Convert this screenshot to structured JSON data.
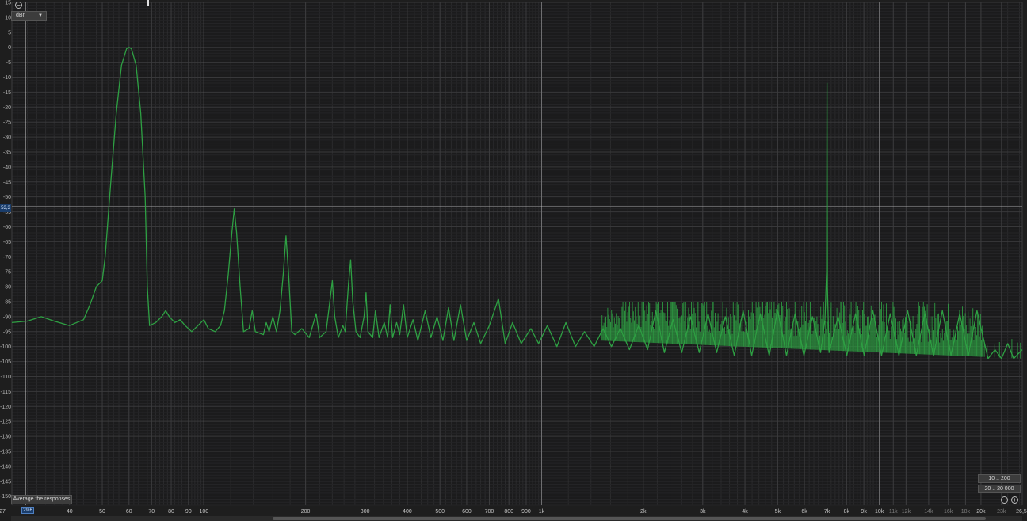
{
  "chart_data": {
    "type": "line",
    "x_scale": "log",
    "xlim": [
      27,
      26500
    ],
    "ylim": [
      -153,
      15
    ],
    "grid": true,
    "line_color": "#2ea043",
    "y_unit_selector": "dBr",
    "y_ticks": [
      "15",
      "10",
      "5",
      "0",
      "-5",
      "-10",
      "-15",
      "-20",
      "-25",
      "-30",
      "-35",
      "-40",
      "-45",
      "-50",
      "-55",
      "-60",
      "-65",
      "-70",
      "-75",
      "-80",
      "-85",
      "-90",
      "-95",
      "-100",
      "-105",
      "-110",
      "-115",
      "-120",
      "-125",
      "-130",
      "-135",
      "-140",
      "-145",
      "-150"
    ],
    "x_ticks": [
      {
        "f": 27,
        "label": "27"
      },
      {
        "f": 40,
        "label": "40"
      },
      {
        "f": 50,
        "label": "50"
      },
      {
        "f": 60,
        "label": "60"
      },
      {
        "f": 70,
        "label": "70"
      },
      {
        "f": 80,
        "label": "80"
      },
      {
        "f": 90,
        "label": "90"
      },
      {
        "f": 100,
        "label": "100"
      },
      {
        "f": 200,
        "label": "200"
      },
      {
        "f": 300,
        "label": "300"
      },
      {
        "f": 400,
        "label": "400"
      },
      {
        "f": 500,
        "label": "500"
      },
      {
        "f": 600,
        "label": "600"
      },
      {
        "f": 700,
        "label": "700"
      },
      {
        "f": 800,
        "label": "800"
      },
      {
        "f": 900,
        "label": "900"
      },
      {
        "f": 1000,
        "label": "1k"
      },
      {
        "f": 2000,
        "label": "2k"
      },
      {
        "f": 3000,
        "label": "3k"
      },
      {
        "f": 4000,
        "label": "4k"
      },
      {
        "f": 5000,
        "label": "5k"
      },
      {
        "f": 6000,
        "label": "6k"
      },
      {
        "f": 7000,
        "label": "7k"
      },
      {
        "f": 8000,
        "label": "8k"
      },
      {
        "f": 9000,
        "label": "9k"
      },
      {
        "f": 10000,
        "label": "10k"
      },
      {
        "f": 11000,
        "label": "11k",
        "dim": true
      },
      {
        "f": 12000,
        "label": "12k",
        "dim": true
      },
      {
        "f": 14000,
        "label": "14k",
        "dim": true
      },
      {
        "f": 16000,
        "label": "16k",
        "dim": true
      },
      {
        "f": 18000,
        "label": "18k",
        "dim": true
      },
      {
        "f": 20000,
        "label": "20k"
      },
      {
        "f": 23000,
        "label": "23k",
        "dim": true
      },
      {
        "f": 26500,
        "label": "26,5kHz"
      }
    ],
    "series": [
      {
        "values": [
          [
            27,
            -92
          ],
          [
            30,
            -91.5
          ],
          [
            33,
            -90
          ],
          [
            36,
            -91.5
          ],
          [
            40,
            -93
          ],
          [
            44,
            -91
          ],
          [
            46,
            -86
          ],
          [
            48,
            -80
          ],
          [
            50,
            -78
          ],
          [
            51,
            -70
          ],
          [
            53,
            -45
          ],
          [
            55,
            -22
          ],
          [
            57,
            -6
          ],
          [
            59,
            -0.5
          ],
          [
            60,
            0
          ],
          [
            61,
            -0.5
          ],
          [
            63,
            -6
          ],
          [
            65,
            -22
          ],
          [
            67,
            -50
          ],
          [
            68,
            -80
          ],
          [
            69,
            -93
          ],
          [
            72,
            -92
          ],
          [
            75,
            -90
          ],
          [
            77,
            -88
          ],
          [
            79,
            -90
          ],
          [
            82,
            -92
          ],
          [
            85,
            -91
          ],
          [
            88,
            -93
          ],
          [
            92,
            -95
          ],
          [
            96,
            -93
          ],
          [
            100,
            -91
          ],
          [
            103,
            -94
          ],
          [
            108,
            -95
          ],
          [
            112,
            -93
          ],
          [
            115,
            -88
          ],
          [
            118,
            -76
          ],
          [
            121,
            -62
          ],
          [
            123,
            -54
          ],
          [
            125,
            -62
          ],
          [
            128,
            -80
          ],
          [
            131,
            -95
          ],
          [
            136,
            -94
          ],
          [
            139,
            -88
          ],
          [
            142,
            -95
          ],
          [
            150,
            -96
          ],
          [
            153,
            -92
          ],
          [
            156,
            -95
          ],
          [
            160,
            -90
          ],
          [
            164,
            -95
          ],
          [
            168,
            -88
          ],
          [
            172,
            -75
          ],
          [
            175,
            -63
          ],
          [
            178,
            -75
          ],
          [
            182,
            -95
          ],
          [
            186,
            -96
          ],
          [
            195,
            -94
          ],
          [
            205,
            -97
          ],
          [
            215,
            -89
          ],
          [
            220,
            -97
          ],
          [
            230,
            -95
          ],
          [
            236,
            -85
          ],
          [
            240,
            -78
          ],
          [
            244,
            -90
          ],
          [
            250,
            -97
          ],
          [
            258,
            -93
          ],
          [
            262,
            -95
          ],
          [
            268,
            -79
          ],
          [
            272,
            -71
          ],
          [
            276,
            -85
          ],
          [
            282,
            -95
          ],
          [
            290,
            -97
          ],
          [
            298,
            -90
          ],
          [
            302,
            -82
          ],
          [
            306,
            -95
          ],
          [
            316,
            -97
          ],
          [
            322,
            -88
          ],
          [
            330,
            -97
          ],
          [
            342,
            -92
          ],
          [
            350,
            -97
          ],
          [
            356,
            -86
          ],
          [
            362,
            -97
          ],
          [
            372,
            -92
          ],
          [
            380,
            -96
          ],
          [
            390,
            -86
          ],
          [
            400,
            -97
          ],
          [
            416,
            -91
          ],
          [
            430,
            -98
          ],
          [
            452,
            -88
          ],
          [
            470,
            -97
          ],
          [
            490,
            -90
          ],
          [
            510,
            -98
          ],
          [
            530,
            -87
          ],
          [
            550,
            -98
          ],
          [
            575,
            -86
          ],
          [
            600,
            -98
          ],
          [
            630,
            -92
          ],
          [
            660,
            -99
          ],
          [
            700,
            -93
          ],
          [
            745,
            -84
          ],
          [
            780,
            -99
          ],
          [
            820,
            -92
          ],
          [
            870,
            -99
          ],
          [
            930,
            -94
          ],
          [
            980,
            -99
          ],
          [
            1040,
            -93
          ],
          [
            1110,
            -100
          ],
          [
            1180,
            -92
          ],
          [
            1260,
            -100
          ],
          [
            1340,
            -95
          ],
          [
            1430,
            -100
          ],
          [
            1520,
            -94
          ],
          [
            1610,
            -100
          ],
          [
            1710,
            -94
          ],
          [
            1820,
            -101
          ],
          [
            1940,
            -93
          ],
          [
            2060,
            -101
          ],
          [
            2180,
            -88
          ],
          [
            2310,
            -102
          ],
          [
            2450,
            -91
          ],
          [
            2600,
            -102
          ],
          [
            2760,
            -90
          ],
          [
            2930,
            -102
          ],
          [
            3110,
            -89
          ],
          [
            3300,
            -102
          ],
          [
            3500,
            -90
          ],
          [
            3720,
            -103
          ],
          [
            3950,
            -88
          ],
          [
            4190,
            -103
          ],
          [
            4440,
            -89
          ],
          [
            4720,
            -103
          ],
          [
            5000,
            -88
          ],
          [
            5310,
            -103
          ],
          [
            5630,
            -89
          ],
          [
            5980,
            -103
          ],
          [
            6340,
            -90
          ],
          [
            6700,
            -102
          ],
          [
            6900,
            -91
          ],
          [
            6980,
            -75
          ],
          [
            7000,
            -12
          ],
          [
            7020,
            -80
          ],
          [
            7100,
            -102
          ],
          [
            7550,
            -90
          ],
          [
            8010,
            -103
          ],
          [
            8500,
            -89
          ],
          [
            9020,
            -103
          ],
          [
            9570,
            -88
          ],
          [
            10150,
            -103
          ],
          [
            10770,
            -89
          ],
          [
            11430,
            -103
          ],
          [
            12130,
            -88
          ],
          [
            12870,
            -103
          ],
          [
            13650,
            -89
          ],
          [
            14480,
            -103
          ],
          [
            15370,
            -88
          ],
          [
            16300,
            -103
          ],
          [
            17300,
            -89
          ],
          [
            18350,
            -103
          ],
          [
            19470,
            -88
          ],
          [
            20300,
            -97
          ],
          [
            21000,
            -104
          ],
          [
            22000,
            -101
          ],
          [
            23000,
            -104
          ],
          [
            24000,
            -99
          ],
          [
            25000,
            -104
          ],
          [
            26500,
            -101
          ]
        ]
      }
    ]
  },
  "ui": {
    "unit_select": "dBr",
    "cursor_y": "53,3",
    "cursor_x": "29,6",
    "average_button": "Average the responses",
    "range_1": "10 .. 200",
    "range_2": "20 .. 20 000"
  }
}
